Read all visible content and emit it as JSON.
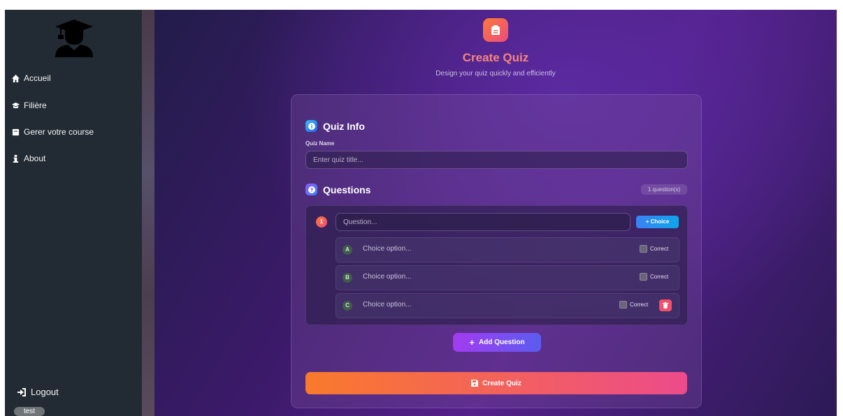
{
  "sidebar": {
    "items": [
      {
        "label": "Accueil",
        "icon": "home-icon"
      },
      {
        "label": "Filière",
        "icon": "graduation-cap-icon"
      },
      {
        "label": "Gerer votre course",
        "icon": "book-icon"
      },
      {
        "label": "About",
        "icon": "info-icon"
      }
    ],
    "logout_label": "Logout",
    "user_label": "test"
  },
  "header": {
    "title": "Create Quiz",
    "subtitle": "Design your quiz quickly and efficiently"
  },
  "quiz_info": {
    "section_title": "Quiz Info",
    "field_label": "Quiz Name",
    "placeholder": "Enter quiz title..."
  },
  "questions": {
    "section_title": "Questions",
    "count_label": "1 question(s)",
    "items": [
      {
        "number": "1",
        "placeholder": "Question...",
        "choice_button": "+ Choice",
        "choices": [
          {
            "letter": "A",
            "placeholder": "Choice option...",
            "correct_label": "Correct",
            "checked": false
          },
          {
            "letter": "B",
            "placeholder": "Choice option...",
            "correct_label": "Correct",
            "checked": false
          },
          {
            "letter": "C",
            "placeholder": "Choice option...",
            "correct_label": "Correct",
            "checked": false
          }
        ]
      }
    ]
  },
  "actions": {
    "add_question": "Add Question",
    "create_quiz": "Create Quiz"
  },
  "colors": {
    "sidebar_bg": "#222b33",
    "title_color": "#f6867b",
    "accent_orange": "#f97a2c",
    "accent_pink": "#ec4b8a",
    "accent_blue": "#3b82f6",
    "accent_purple": "#a33bf0",
    "delete_red": "#f0506a"
  }
}
